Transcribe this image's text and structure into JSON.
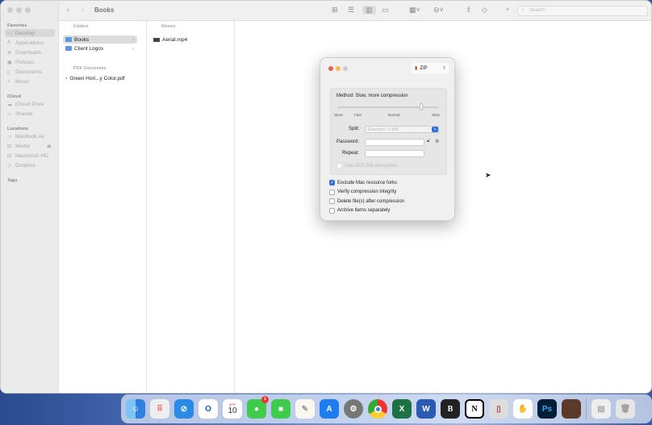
{
  "finder": {
    "title": "Books",
    "search_placeholder": "Search",
    "sidebar": {
      "favorites": "Favorites",
      "fav_items": [
        "Desktop",
        "Applications",
        "Downloads",
        "Pictures",
        "Documents",
        "Music"
      ],
      "icloud": "iCloud",
      "icloud_items": [
        "iCloud Drive",
        "Shared"
      ],
      "locations": "Locations",
      "loc_items": [
        "MacBook Air",
        "Media",
        "Macintosh HD",
        "Dropbox"
      ],
      "tags": "Tags"
    },
    "col1": {
      "header": "Folders",
      "folders": [
        "Books",
        "Client Logos"
      ],
      "pdf_header": "PDF Documents",
      "pdf": "Green Hori...y Color.pdf"
    },
    "col2": {
      "header": "Movies",
      "file": "Aerial.mp4"
    }
  },
  "dialog": {
    "format": "ZIP",
    "method": "Method: Slow, more compression",
    "ticks": [
      "Store",
      "Fast",
      "Normal",
      "Slow"
    ],
    "level": 0.83,
    "split_label": "Split:",
    "split_placeholder": "Example: 5 MB",
    "password_label": "Password:",
    "repeat_label": "Repeat:",
    "aes": "Use AES-256 encryption",
    "options": [
      {
        "label": "Exclude Mac resource forks",
        "checked": true
      },
      {
        "label": "Verify compression integrity",
        "checked": false
      },
      {
        "label": "Delete file(s) after compression",
        "checked": false
      },
      {
        "label": "Archive items separately",
        "checked": false
      }
    ]
  },
  "dock": {
    "calendar_month": "APR",
    "calendar_day": "10",
    "messages_badge": "1",
    "bbedit": "B",
    "notion": "N",
    "photoshop": "Ps"
  }
}
